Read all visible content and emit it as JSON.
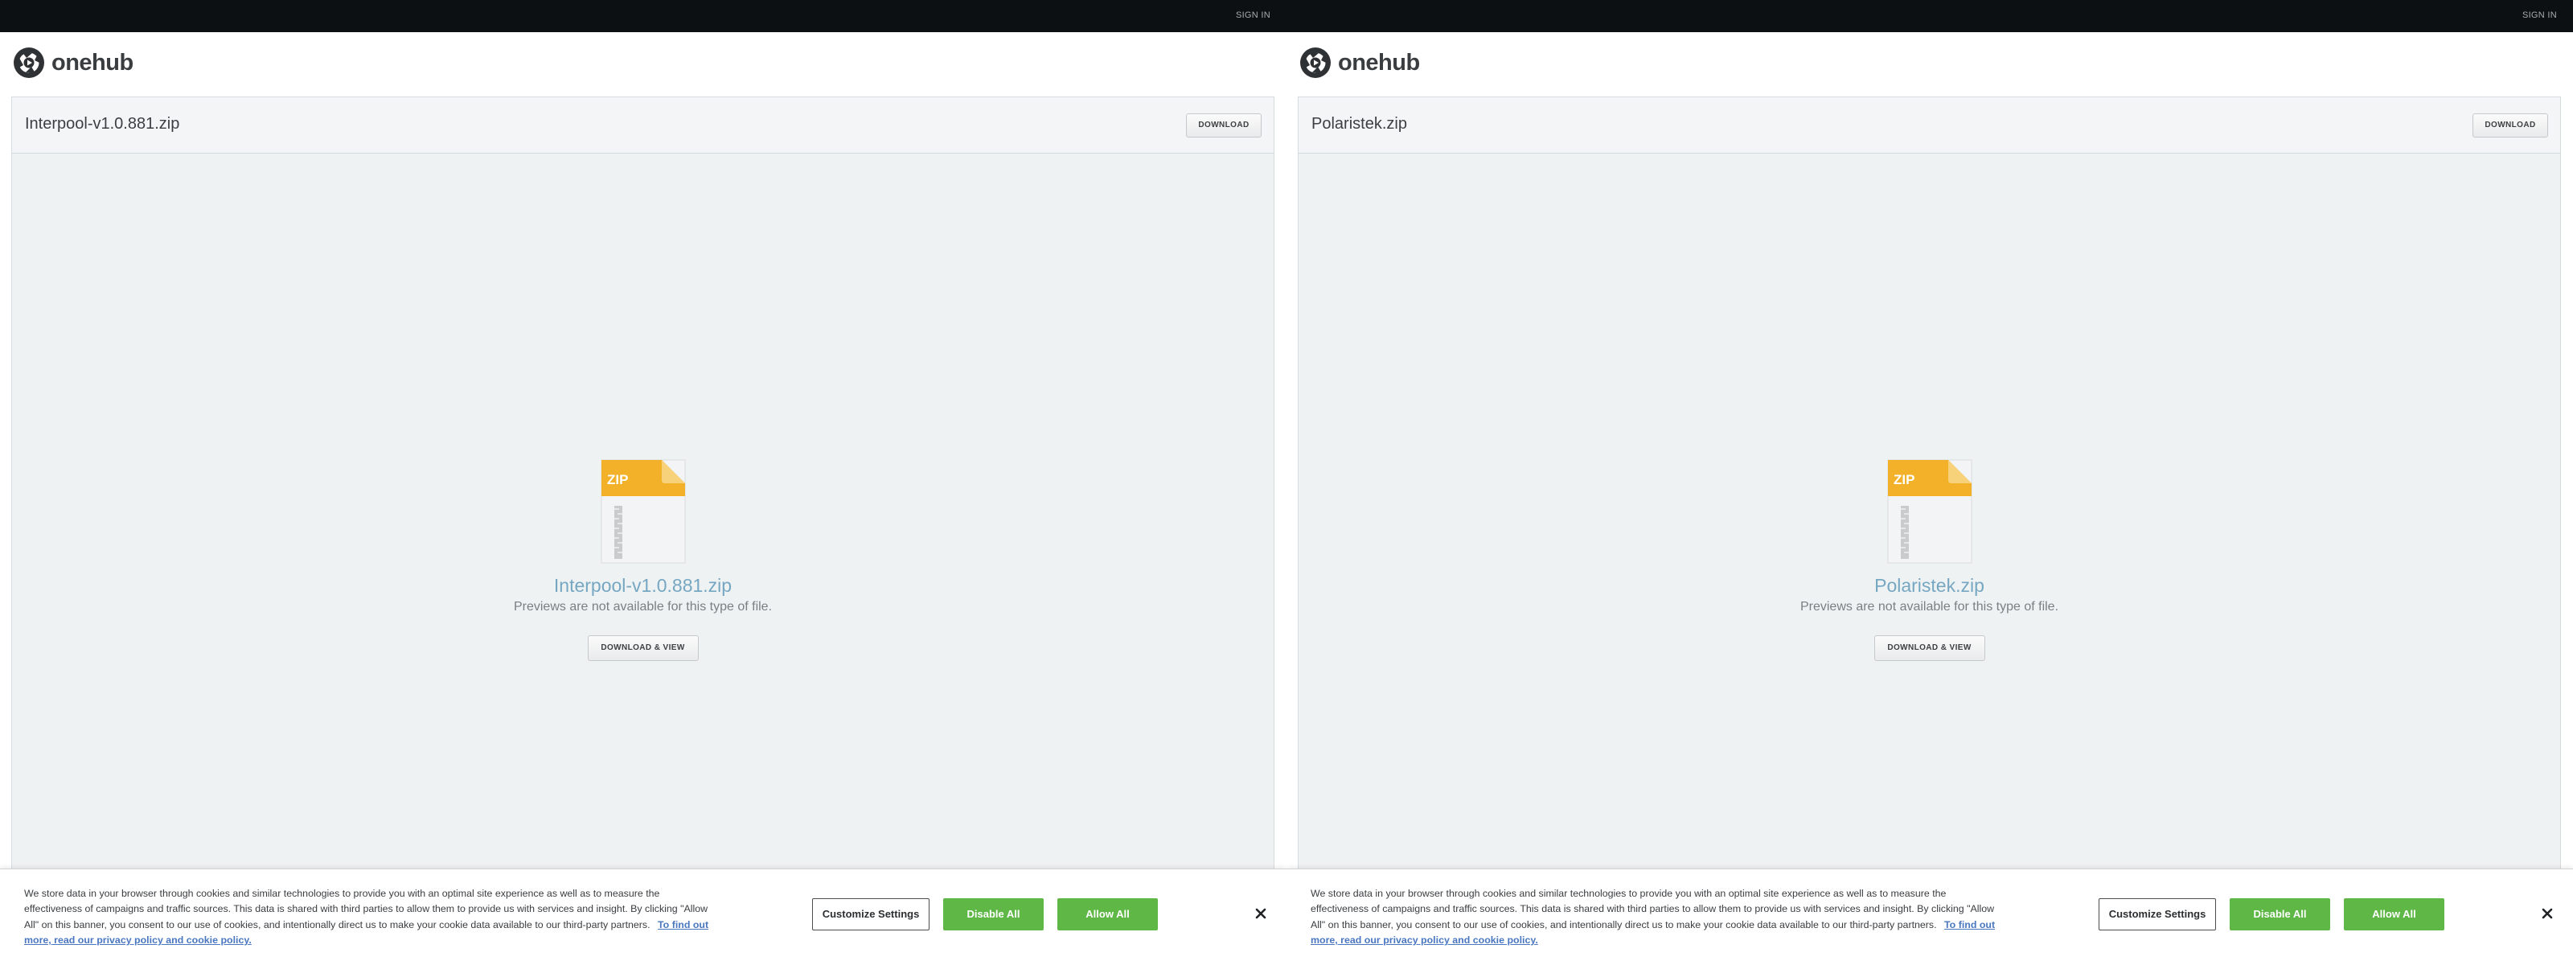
{
  "brand": {
    "name": "onehub"
  },
  "colors": {
    "topbar": "#0d1012",
    "accent_link": "#76a7c2",
    "green_button": "#5fb846",
    "zip_badge": "#f2b128"
  },
  "icons": {
    "logo": "onehub-logo-icon",
    "file": "zip-file-icon",
    "close": "close-icon"
  },
  "panes": [
    {
      "signin": "SIGN IN",
      "file_name": "Interpool-v1.0.881.zip",
      "download_label": "DOWNLOAD",
      "zip_badge": "ZIP",
      "preview_name": "Interpool-v1.0.881.zip",
      "preview_note": "Previews are not available for this type of file.",
      "download_view_label": "DOWNLOAD & VIEW",
      "cookie": {
        "text": "We store data in your browser through cookies and similar technologies to provide you with an optimal site experience as well as to measure the effectiveness of campaigns and traffic sources. This data is shared with third parties to allow them to provide us with services and insight. By clicking \"Allow All\" on this banner, you consent to our use of cookies, and intentionally direct us to make your cookie data available to our third-party partners.",
        "link": "To find out more, read our privacy policy and cookie policy.",
        "customize": "Customize Settings",
        "disable": "Disable All",
        "allow": "Allow All"
      }
    },
    {
      "signin": "SIGN IN",
      "file_name": "Polaristek.zip",
      "download_label": "DOWNLOAD",
      "zip_badge": "ZIP",
      "preview_name": "Polaristek.zip",
      "preview_note": "Previews are not available for this type of file.",
      "download_view_label": "DOWNLOAD & VIEW",
      "cookie": {
        "text": "We store data in your browser through cookies and similar technologies to provide you with an optimal site experience as well as to measure the effectiveness of campaigns and traffic sources. This data is shared with third parties to allow them to provide us with services and insight. By clicking \"Allow All\" on this banner, you consent to our use of cookies, and intentionally direct us to make your cookie data available to our third-party partners.",
        "link": "To find out more, read our privacy policy and cookie policy.",
        "customize": "Customize Settings",
        "disable": "Disable All",
        "allow": "Allow All"
      }
    }
  ]
}
